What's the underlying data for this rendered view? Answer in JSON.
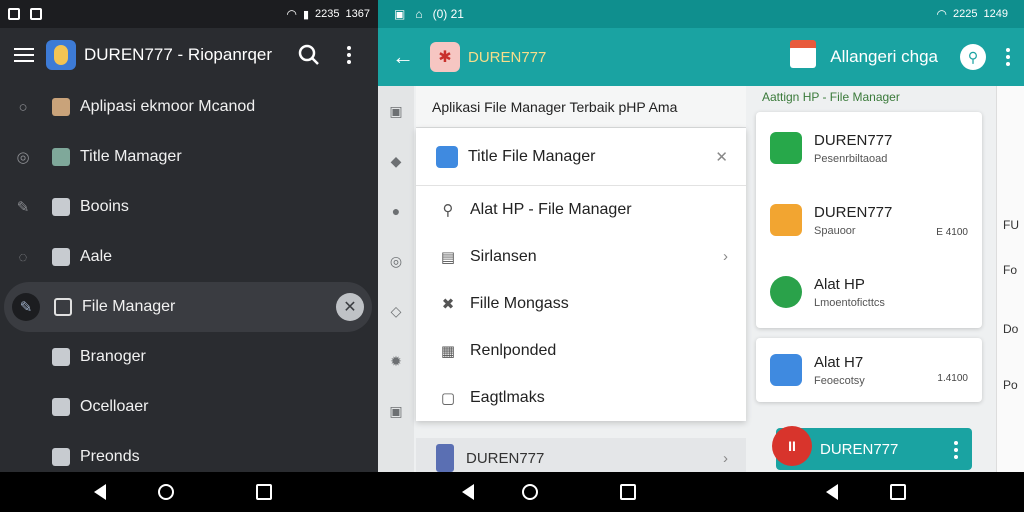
{
  "left": {
    "status": {
      "time": "1367",
      "battery": "2235"
    },
    "appbar": {
      "title": "DUREN777 - Riopanrqer"
    },
    "drawer": [
      {
        "lead": "○",
        "label": "Aplipasi ekmoor Mcanod"
      },
      {
        "lead": "◎",
        "label": "Title Mamager"
      },
      {
        "lead": "✎",
        "label": "Booins"
      },
      {
        "lead": "◌",
        "label": "Aale"
      },
      {
        "lead": "✎",
        "label": "File Manager",
        "active": true
      },
      {
        "lead": "",
        "label": "Branoger"
      },
      {
        "lead": "",
        "label": "Ocelloaer"
      },
      {
        "lead": "",
        "label": "Preonds"
      }
    ]
  },
  "right": {
    "status": {
      "time": "1249",
      "battery": "2225",
      "left_text": "(0) 21"
    },
    "appbar": {
      "brand": "DUREN777",
      "subtitle": "Allangeri chga"
    },
    "menu": {
      "header": "Aplikasi File Manager Terbaik pHP Ama",
      "rows": [
        {
          "label": "Title File Manager",
          "trail": "✕"
        },
        {
          "label": "Alat HP - File Manager",
          "trail": ""
        },
        {
          "label": "Sirlansen",
          "trail": "›"
        },
        {
          "label": "Fille Mongass",
          "trail": ""
        },
        {
          "label": "Renlponded",
          "trail": ""
        },
        {
          "label": "Eagtlmaks",
          "trail": ""
        }
      ],
      "footer": {
        "label": "DUREN777",
        "trail": "›"
      }
    },
    "cards": {
      "caption": "Aattign HP - File Manager",
      "items": [
        {
          "title": "DUREN777",
          "sub": "Pesenrbiltaoad",
          "size": "",
          "color": "#27a84a"
        },
        {
          "title": "DUREN777",
          "sub": "Spauoor",
          "size": "E 4100",
          "color": "#f2a531"
        },
        {
          "title": "Alat HP",
          "sub": "Lmoentoficttcs",
          "size": "",
          "color": "#2aa24a"
        }
      ],
      "second": {
        "title": "Alat H7",
        "sub": "Feoecotsy",
        "size": "1.4100",
        "color": "#3f8ae0"
      },
      "pill": {
        "label": "DUREN777"
      }
    },
    "edge": [
      "FU",
      "Fo",
      "Do",
      "Po"
    ]
  }
}
